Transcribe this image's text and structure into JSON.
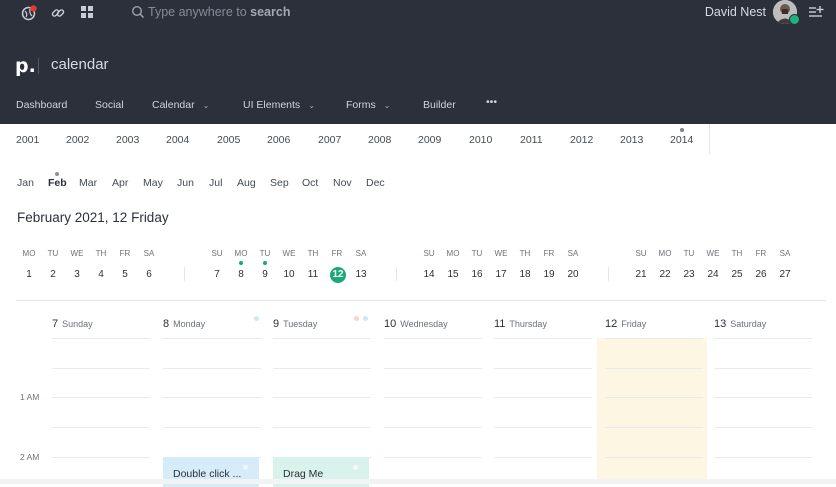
{
  "topbar": {
    "search_placeholder": "Type anywhere to",
    "search_bold": "search",
    "user_name": "David Nest",
    "brand_logo": "p.",
    "brand_title": "calendar",
    "icons": [
      "notification-globe-icon",
      "link-icon",
      "apps-grid-icon",
      "search-icon",
      "add-list-icon"
    ],
    "colors": {
      "bar": "#2b303b",
      "accent": "#1aa87a",
      "notify": "#e53935"
    }
  },
  "nav": [
    {
      "label": "Dashboard",
      "dropdown": false
    },
    {
      "label": "Social",
      "dropdown": false
    },
    {
      "label": "Calendar",
      "dropdown": true
    },
    {
      "label": "UI Elements",
      "dropdown": true
    },
    {
      "label": "Forms",
      "dropdown": true
    },
    {
      "label": "Builder",
      "dropdown": false
    },
    {
      "label": "•••",
      "dropdown": false
    }
  ],
  "years": [
    "2001",
    "2002",
    "2003",
    "2004",
    "2005",
    "2006",
    "2007",
    "2008",
    "2009",
    "2010",
    "2011",
    "2012",
    "2013",
    "2014"
  ],
  "months": [
    "Jan",
    "Feb",
    "Mar",
    "Apr",
    "May",
    "Jun",
    "Jul",
    "Aug",
    "Sep",
    "Oct",
    "Nov",
    "Dec"
  ],
  "active_month": "Feb",
  "date_heading": "February 2021, 12 Friday",
  "week_strip": {
    "day_names_a": [
      "MO",
      "TU",
      "WE",
      "TH",
      "FR",
      "SA"
    ],
    "day_names_b": [
      "SU",
      "MO",
      "TU",
      "WE",
      "TH",
      "FR",
      "SA"
    ],
    "week1": [
      "1",
      "2",
      "3",
      "4",
      "5",
      "6"
    ],
    "week2": [
      "7",
      "8",
      "9",
      "10",
      "11",
      "12",
      "13"
    ],
    "week3": [
      "14",
      "15",
      "16",
      "17",
      "18",
      "19",
      "20"
    ],
    "week4": [
      "21",
      "22",
      "23",
      "24",
      "25",
      "26",
      "27"
    ],
    "selected": "12"
  },
  "columns": [
    {
      "num": "7",
      "name": "Sunday"
    },
    {
      "num": "8",
      "name": "Monday"
    },
    {
      "num": "9",
      "name": "Tuesday"
    },
    {
      "num": "10",
      "name": "Wednesday"
    },
    {
      "num": "11",
      "name": "Thursday"
    },
    {
      "num": "12",
      "name": "Friday"
    },
    {
      "num": "13",
      "name": "Saturday"
    }
  ],
  "time_labels": [
    "1 AM",
    "2 AM"
  ],
  "events": [
    {
      "label": "Double click ...",
      "color": "#d6ecf8"
    },
    {
      "label": "Drag Me",
      "color": "#d9f2ec"
    }
  ]
}
